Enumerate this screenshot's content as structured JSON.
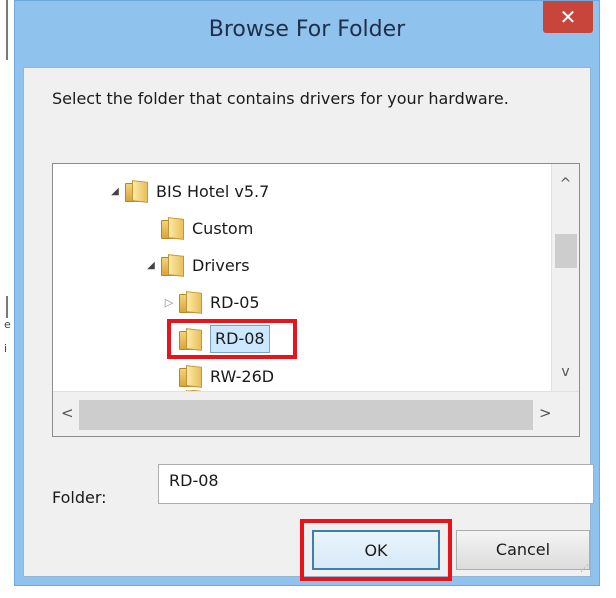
{
  "dialog": {
    "title": "Browse For Folder",
    "close_glyph": "✕",
    "instruction": "Select the folder that contains drivers for your hardware.",
    "tree": {
      "items": [
        {
          "label": "BIS Hotel v5.7",
          "expander": "◢",
          "level": 0
        },
        {
          "label": "Custom",
          "expander": "",
          "level": 1
        },
        {
          "label": "Drivers",
          "expander": "◢",
          "level": 1
        },
        {
          "label": "RD-05",
          "expander": "▷",
          "level": 2
        },
        {
          "label": "RD-08",
          "expander": "",
          "level": 2,
          "selected": true
        },
        {
          "label": "RW-26D",
          "expander": "",
          "level": 2
        }
      ],
      "vscroll_up": "^",
      "vscroll_down": "v",
      "hscroll_left": "<",
      "hscroll_right": ">"
    },
    "folder_label": "Folder:",
    "folder_value": "RD-08",
    "ok_label": "OK",
    "cancel_label": "Cancel"
  },
  "background": {
    "fragment_texts": [
      "e",
      "i"
    ]
  },
  "colors": {
    "title_bar": "#8fc2ec",
    "close_button": "#c7453a",
    "highlight_box": "#e8141a",
    "selection": "#cce8ff"
  },
  "icons": [
    "close-icon",
    "folder-icon",
    "expand-arrow-icon",
    "collapse-arrow-icon",
    "resize-grip-icon"
  ]
}
